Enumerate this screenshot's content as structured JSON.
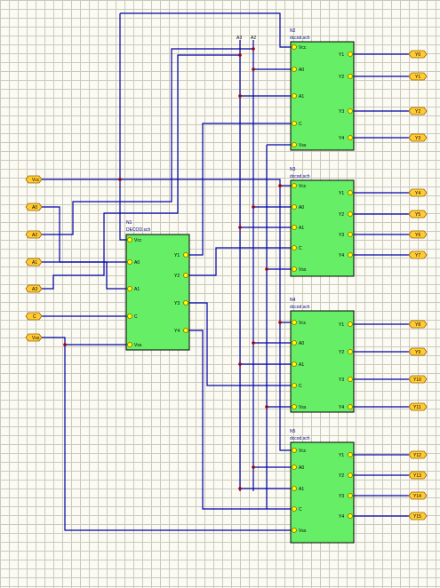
{
  "top_labels": {
    "a3": "A3",
    "a2": "A2"
  },
  "input_ports": [
    "Vcc",
    "A0",
    "A2",
    "A1",
    "A3",
    "C",
    "Vss"
  ],
  "blocks": {
    "n1": {
      "ref": "N1",
      "file": "DECOD.sch",
      "pins_left": [
        "Vcc",
        "A0",
        "A1",
        "C",
        "Vss"
      ],
      "pins_right": [
        "Y1",
        "Y2",
        "Y3",
        "Y4"
      ]
    },
    "n2": {
      "ref": "N2",
      "file": "dccod.sch",
      "pins_left": [
        "Vcc",
        "A0",
        "A1",
        "C",
        "Vss"
      ],
      "pins_right": [
        "Y1",
        "Y2",
        "Y3",
        "Y4"
      ]
    },
    "n3": {
      "ref": "N3",
      "file": "dccod.sch",
      "pins_left": [
        "Vcc",
        "A0",
        "A1",
        "C",
        "Vss"
      ],
      "pins_right": [
        "Y1",
        "Y2",
        "Y3",
        "Y4"
      ]
    },
    "n4": {
      "ref": "N4",
      "file": "dccod.sch",
      "pins_left": [
        "Vcc",
        "A0",
        "A1",
        "C",
        "Vss"
      ],
      "pins_right": [
        "Y1",
        "Y2",
        "Y3",
        "Y4"
      ]
    },
    "n5": {
      "ref": "N5",
      "file": "dccod.sch",
      "pins_left": [
        "Vcc",
        "A0",
        "A1",
        "C",
        "Vss"
      ],
      "pins_right": [
        "Y1",
        "Y2",
        "Y3",
        "Y4"
      ]
    }
  },
  "output_ports": {
    "n2": [
      "Y0",
      "Y1",
      "Y2",
      "Y3"
    ],
    "n3": [
      "Y4",
      "Y5",
      "Y6",
      "Y7"
    ],
    "n4": [
      "Y8",
      "Y9",
      "Y10",
      "Y11"
    ],
    "n5": [
      "Y12",
      "Y13",
      "Y14",
      "Y15"
    ]
  },
  "colors": {
    "wire": "#0000a8",
    "block": "#66ee66",
    "pin": "#ffff00",
    "port": "#ffcc33",
    "junction": "#a00000"
  }
}
